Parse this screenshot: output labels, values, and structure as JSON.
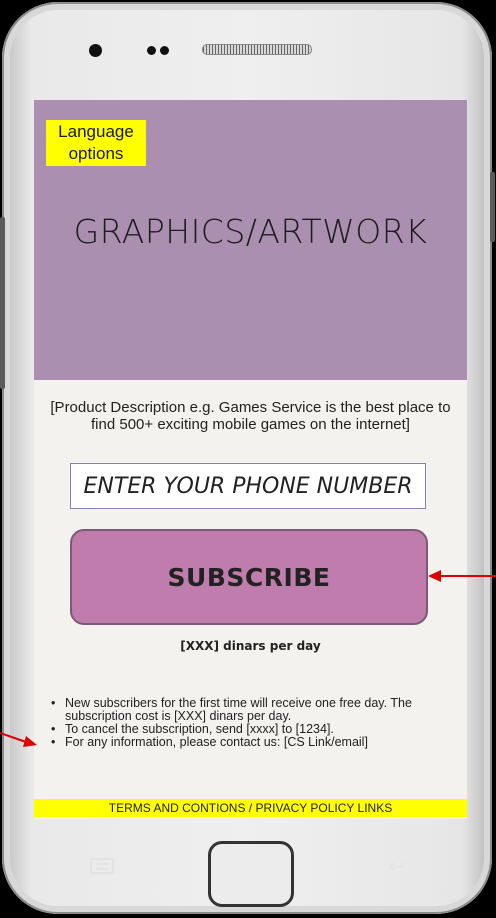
{
  "header": {
    "language_label": "Language options"
  },
  "hero": {
    "placeholder_label": "GRAPHICS/ARTWORK"
  },
  "product": {
    "description": "[Product Description e.g. Games Service is the best place to find 500+ exciting mobile games on the internet]"
  },
  "form": {
    "phone_placeholder": "ENTER YOUR PHONE NUMBER",
    "subscribe_label": "SUBSCRIBE",
    "price_text": "[XXX] dinars per day"
  },
  "info": {
    "items": [
      "New subscribers for the first time will receive one free day. The subscription cost is [XXX] dinars per day.",
      "To cancel the subscription, send [xxxx] to [1234].",
      "For any information, please contact us: [CS Link/email]"
    ]
  },
  "footer": {
    "terms_label": "TERMS AND CONTIONS",
    "separator": " / ",
    "privacy_label": "PRIVACY POLICY LINKS"
  },
  "colors": {
    "hero_bg": "#ab8fb1",
    "subscribe_bg": "#bf7cad",
    "highlight_yellow": "#ffff00",
    "annotation_red": "#e00000"
  },
  "icons": {
    "menu": "menu-icon",
    "back": "back-icon",
    "home": "home-button"
  }
}
